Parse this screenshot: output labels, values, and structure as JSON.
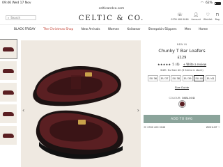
{
  "status_bar": {
    "time": "09:46",
    "date": "Wed 17 Nov",
    "battery": "62%"
  },
  "browser": {
    "url": "celticandco.com"
  },
  "header": {
    "search_placeholder": "Search",
    "logo": "CELTIC & CO.",
    "phone": "0330 400 0046",
    "account": "Account",
    "wishlist": "Wishlist",
    "bag": "Bag"
  },
  "nav": [
    "BLACK FRIDAY",
    "The Christmas Shop",
    "New Arrivals",
    "Women",
    "Knitwear",
    "Sheepskin Slippers",
    "Men",
    "Home"
  ],
  "product": {
    "badge": "NEW IN",
    "title": "Chunky T Bar Loafers",
    "price": "£129",
    "stars": "★★★★★",
    "rating": "5",
    "review_count": "(6)",
    "write_review": "+ Write a review",
    "size_note": "SIZE: Eu Size 40 (3 items in stock)",
    "sizes": [
      "EU 36",
      "EU 37",
      "EU 38",
      "EU 39",
      "EU 40",
      "EU 41"
    ],
    "size_guide": "Size Guide",
    "colour_label": "COLOUR:",
    "colour_value": "OXBLOOD",
    "add_to_bag": "ADD TO BAG",
    "phone": "0330 400 0046",
    "wishlist": "WISHLIST"
  },
  "colors": {
    "oxblood": "#5a1f22",
    "add_to_bag": "#8ba49b",
    "sale": "#c0392b",
    "image_bg": "#efe9e1"
  }
}
